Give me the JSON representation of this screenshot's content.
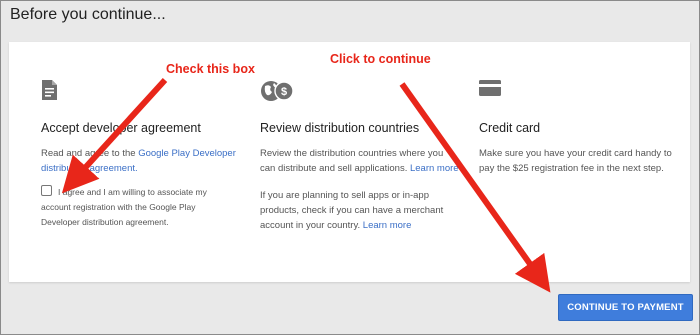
{
  "dialog": {
    "title": "Before you continue..."
  },
  "columns": [
    {
      "icon": "document-icon",
      "title": "Accept developer agreement",
      "body_prefix": "Read and agree to the ",
      "body_link": "Google Play Developer distribution agreement.",
      "checkbox_checked": false,
      "checkbox_label": "I agree and I am willing to associate my account registration with the Google Play Developer distribution agreement."
    },
    {
      "icon": "globe-dollar-icon",
      "title": "Review distribution countries",
      "body1": "Review the distribution countries where you can distribute and sell applications.",
      "link1": "Learn more",
      "body2": "If you are planning to sell apps or in-app products, check if you can have a merchant account in your country.",
      "link2": "Learn more"
    },
    {
      "icon": "credit-card-icon",
      "title": "Credit card",
      "body": "Make sure you have your credit card handy to pay the $25 registration fee in the next step."
    }
  ],
  "annotations": {
    "check_box": "Check this box",
    "click_continue": "Click to continue",
    "color": "#e8261a"
  },
  "actions": {
    "continue_label": "CONTINUE TO PAYMENT"
  },
  "colors": {
    "accent": "#3f7ddc",
    "link": "#3b6fc6"
  }
}
